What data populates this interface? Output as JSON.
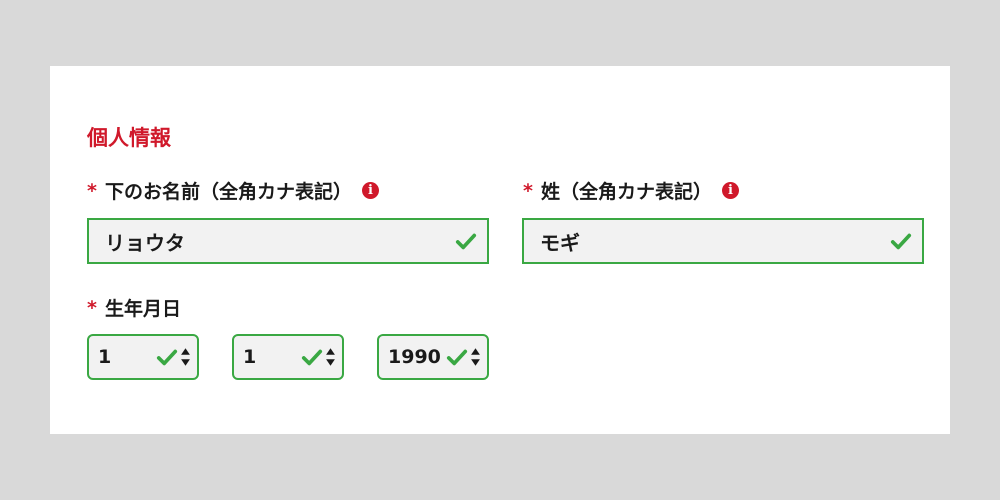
{
  "section": {
    "title": "個人情報"
  },
  "required_mark": "*",
  "first_name": {
    "label": "下のお名前（全角カナ表記）",
    "value": "リョウタ",
    "status": "valid"
  },
  "last_name": {
    "label": "姓（全角カナ表記）",
    "value": "モギ",
    "status": "valid"
  },
  "birthdate": {
    "label": "生年月日",
    "selects": [
      {
        "value": "1",
        "status": "valid"
      },
      {
        "value": "1",
        "status": "valid"
      },
      {
        "value": "1990",
        "status": "valid"
      }
    ]
  },
  "colors": {
    "accent_red": "#d0192b",
    "valid_green": "#3aa843",
    "input_bg": "#f2f2f2",
    "page_bg": "#d9d9d9"
  },
  "icons": {
    "info": "info-icon",
    "valid": "check-icon",
    "select_arrows": "spinner-arrows-icon"
  }
}
